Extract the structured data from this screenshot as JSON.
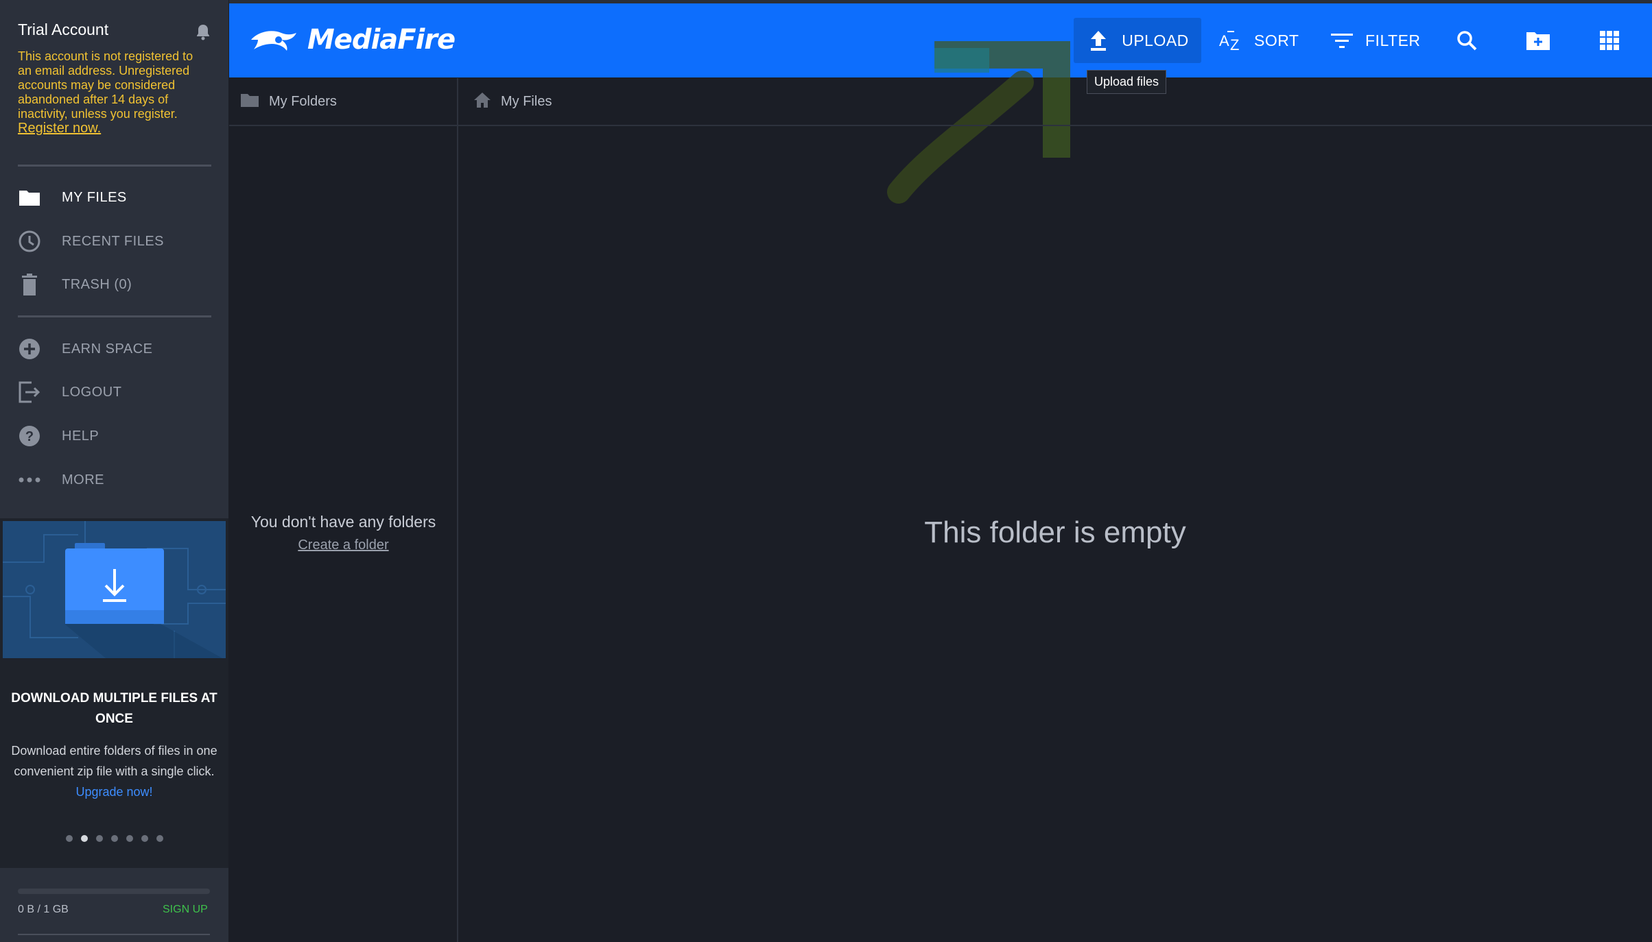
{
  "sidebar": {
    "account_title": "Trial Account",
    "notice_text": "This account is not registered to an email address. Unregistered accounts may be considered abandoned after 14 days of inactivity, unless you register.",
    "register_link": "Register now.",
    "nav": [
      {
        "label": "MY FILES",
        "icon": "folder-icon"
      },
      {
        "label": "RECENT FILES",
        "icon": "clock-icon"
      },
      {
        "label": "TRASH (0)",
        "icon": "trash-icon"
      },
      {
        "label": "EARN SPACE",
        "icon": "plus-circle-icon"
      },
      {
        "label": "LOGOUT",
        "icon": "logout-icon"
      },
      {
        "label": "HELP",
        "icon": "help-icon"
      },
      {
        "label": "MORE",
        "icon": "more-dots-icon"
      }
    ],
    "promo": {
      "title": "DOWNLOAD MULTIPLE FILES AT ONCE",
      "desc": "Download entire folders of files in one convenient zip file with a single click.",
      "link": "Upgrade now!",
      "slides": 7,
      "active_slide": 2
    },
    "storage": {
      "text": "0 B / 1 GB",
      "used_fraction": 0,
      "signup": "SIGN UP"
    }
  },
  "topbar": {
    "brand": "MediaFire",
    "upload": "UPLOAD",
    "sort": "SORT",
    "filter": "FILTER",
    "upload_tooltip": "Upload files",
    "accent_color": "#0d6efd"
  },
  "folders": {
    "header": "My Folders",
    "empty": "You don't have any folders",
    "create_link": "Create a folder"
  },
  "files": {
    "breadcrumb": "My Files",
    "empty": "This folder is empty"
  }
}
